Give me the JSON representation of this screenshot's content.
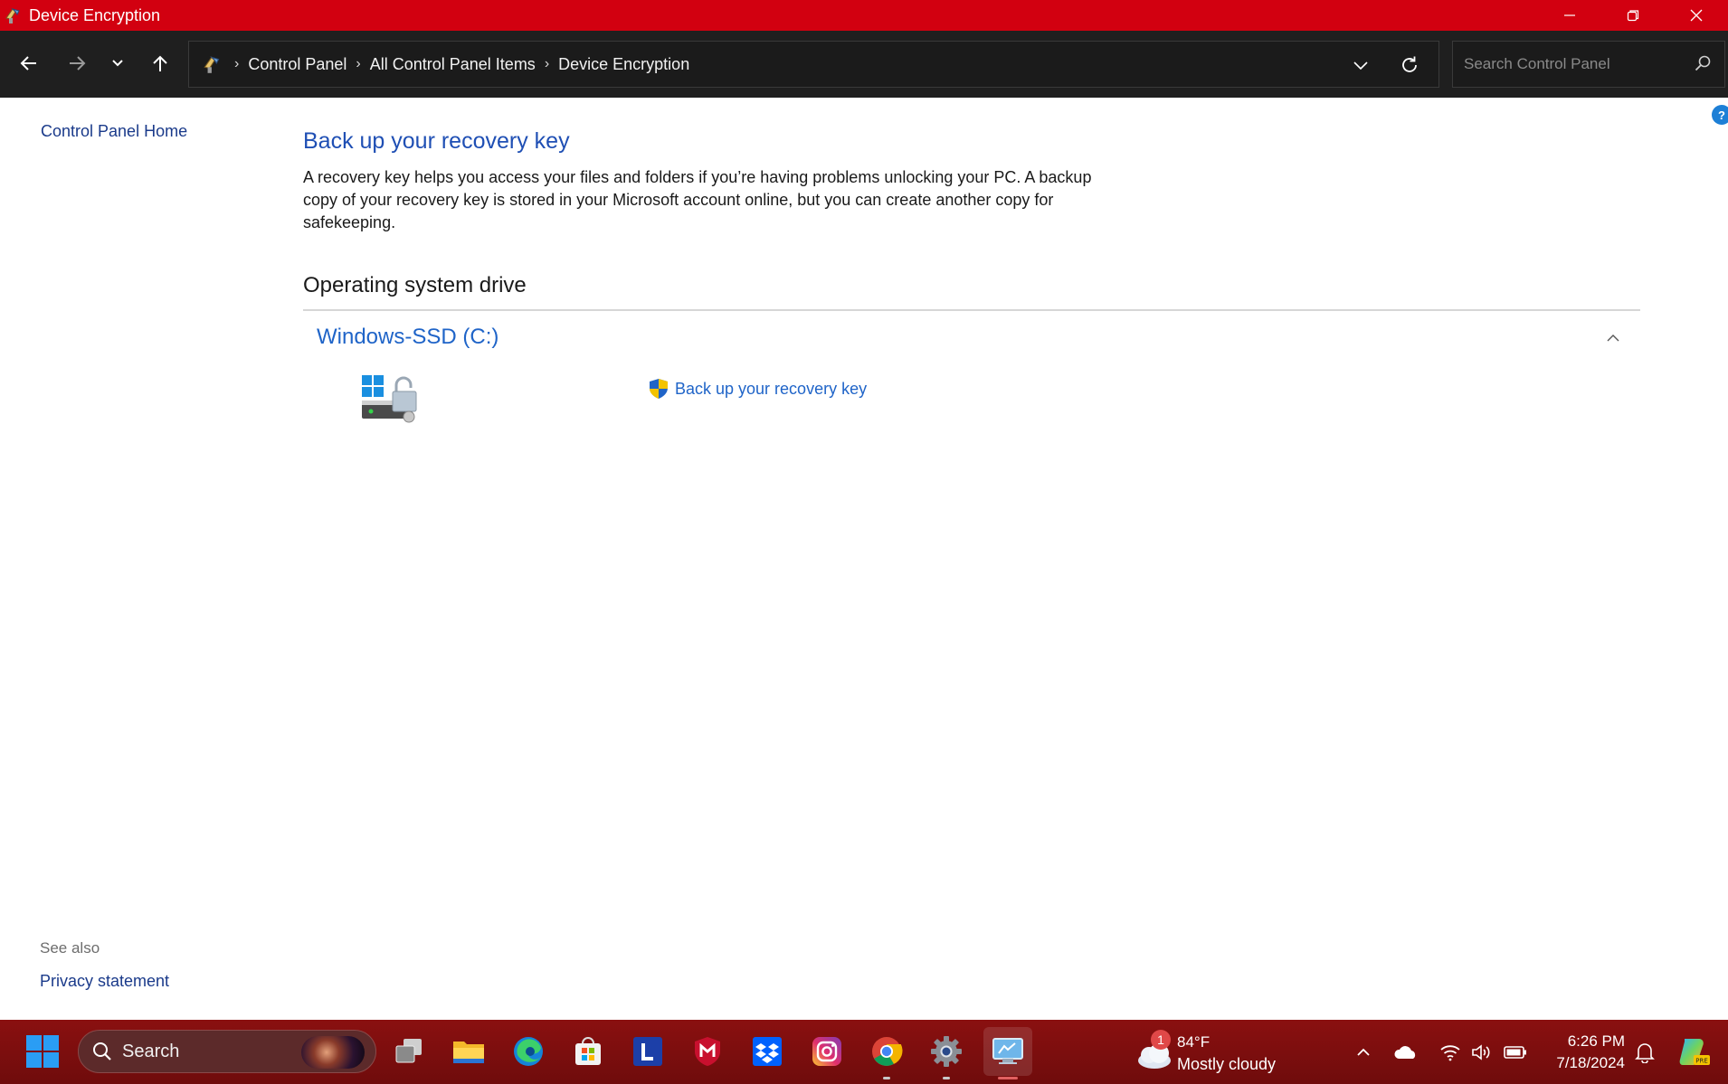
{
  "window": {
    "title": "Device Encryption"
  },
  "navbar": {
    "breadcrumbs": [
      "Control Panel",
      "All Control Panel Items",
      "Device Encryption"
    ],
    "search_placeholder": "Search Control Panel"
  },
  "left_pane": {
    "home_link": "Control Panel Home",
    "see_also_label": "See also",
    "privacy_link": "Privacy statement"
  },
  "main": {
    "page_title": "Back up your recovery key",
    "description": "A recovery key helps you access your files and folders if you’re having problems unlocking your PC. A backup copy of your recovery key is stored in your Microsoft account online, but you can create another copy for safekeeping.",
    "section_title": "Operating system drive",
    "drive_name": "Windows-SSD (C:)",
    "backup_link": "Back up your recovery key"
  },
  "taskbar": {
    "search_label": "Search",
    "apps": [
      "task-view",
      "file-explorer",
      "edge",
      "microsoft-store",
      "l-app",
      "mcafee",
      "dropbox",
      "instagram",
      "chrome",
      "settings",
      "control-panel"
    ],
    "weather": {
      "temperature": "84°F",
      "condition": "Mostly cloudy",
      "badge": "1"
    },
    "clock": {
      "time": "6:26 PM",
      "date": "7/18/2024"
    }
  },
  "colors": {
    "titlebar": "#d20010",
    "navbar": "#1f1f1f",
    "link": "#1f64c8",
    "taskbar": "#7b0d0d"
  }
}
